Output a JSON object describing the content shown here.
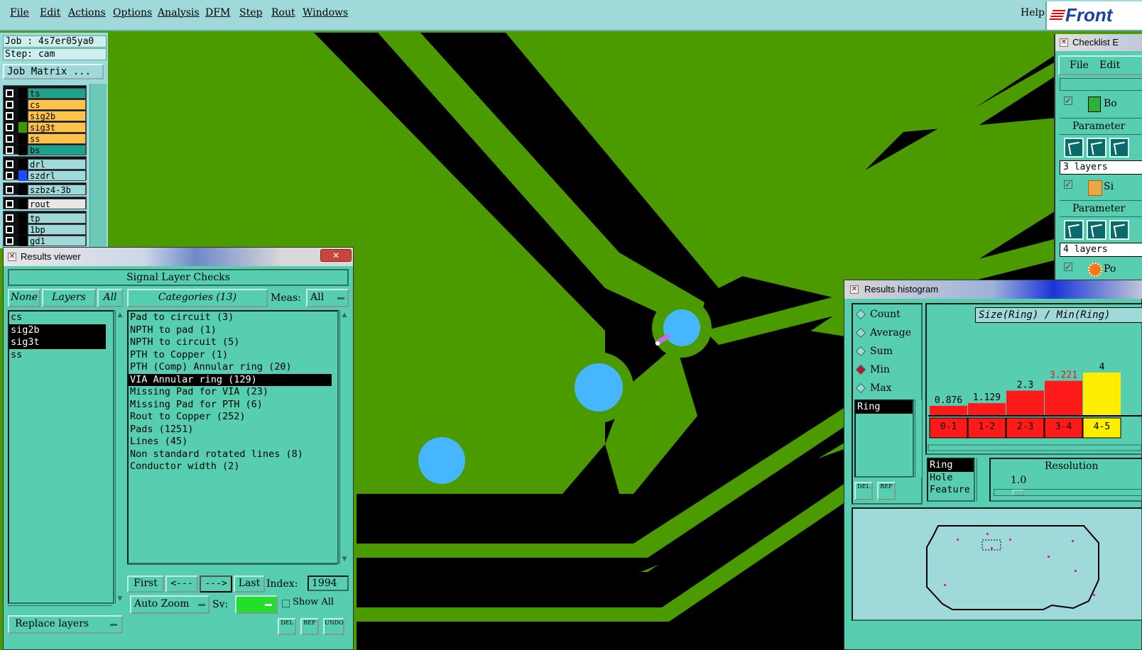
{
  "menu": {
    "items": [
      "File",
      "Edit",
      "Actions",
      "Options",
      "Analysis",
      "DFM",
      "Step",
      "Rout",
      "Windows"
    ],
    "help": "Help",
    "logo": "Front"
  },
  "left_panel": {
    "job": "Job : 4s7er05ya0",
    "step": "Step: cam",
    "job_matrix": "Job Matrix ...",
    "layers": [
      {
        "name": "ts",
        "color": "#1ea28c",
        "swatch": "#000000",
        "flag": "↵"
      },
      {
        "name": "cs",
        "color": "#ffc24a",
        "swatch": "#000000",
        "flag": "↵"
      },
      {
        "name": "sig2b",
        "color": "#ffc24a",
        "swatch": "#000000",
        "flag": "↵"
      },
      {
        "name": "sig3t",
        "color": "#ffc24a",
        "swatch": "#3a9a00",
        "flag": "↵"
      },
      {
        "name": "ss",
        "color": "#ffc24a",
        "swatch": "#000000",
        "flag": "↵"
      },
      {
        "name": "bs",
        "color": "#1ea28c",
        "swatch": "#000000",
        "flag": ""
      },
      {
        "name": "drl",
        "color": "#9fd9d9",
        "swatch": "#000000",
        "flag": ""
      },
      {
        "name": "szdrl",
        "color": "#9fd9d9",
        "swatch": "#1d4bff",
        "flag": "⊞"
      },
      {
        "name": "szbz4-3b",
        "color": "#9fd9d9",
        "swatch": "#000000",
        "flag": ""
      },
      {
        "name": "rout",
        "color": "#e6e6e6",
        "swatch": "#000000",
        "flag": ""
      },
      {
        "name": "tp",
        "color": "#9fd9d9",
        "swatch": "#000000",
        "flag": ""
      },
      {
        "name": "1bp",
        "color": "#9fd9d9",
        "swatch": "#000000",
        "flag": ""
      },
      {
        "name": "gd1",
        "color": "#9fd9d9",
        "swatch": "#000000",
        "flag": "↵"
      }
    ]
  },
  "results_viewer": {
    "title": "Results viewer",
    "header": "Signal Layer Checks",
    "none_label": "None",
    "layers_label": "Layers",
    "all_label": "All",
    "categories_label": "Categories (13)",
    "meas_label": "Meas:",
    "meas_value": "All",
    "layer_list": [
      {
        "name": "cs",
        "selected": false
      },
      {
        "name": "sig2b",
        "selected": true
      },
      {
        "name": "sig3t",
        "selected": true
      },
      {
        "name": "ss",
        "selected": false
      }
    ],
    "categories": [
      {
        "name": "Pad to circuit (3)",
        "selected": false
      },
      {
        "name": "NPTH to pad (1)",
        "selected": false
      },
      {
        "name": "NPTH to circuit (5)",
        "selected": false
      },
      {
        "name": "PTH to Copper (1)",
        "selected": false
      },
      {
        "name": "PTH (Comp) Annular ring (20)",
        "selected": false
      },
      {
        "name": "VIA Annular ring (129)",
        "selected": true
      },
      {
        "name": "Missing Pad for VIA (23)",
        "selected": false
      },
      {
        "name": "Missing Pad for PTH (6)",
        "selected": false
      },
      {
        "name": "Rout to Copper (252)",
        "selected": false
      },
      {
        "name": "Pads (1251)",
        "selected": false
      },
      {
        "name": "Lines (45)",
        "selected": false
      },
      {
        "name": "Non standard rotated lines (8)",
        "selected": false
      },
      {
        "name": "Conductor width (2)",
        "selected": false
      }
    ],
    "first": "First",
    "prev": "<---",
    "next": "--->",
    "last": "Last",
    "index_label": "Index:",
    "index_value": "1994",
    "auto_zoom": "Auto Zoom",
    "sv_label": "Sv:",
    "show_all": "Show All",
    "replace_layers": "Replace layers",
    "del": "DEL",
    "ref": "REF",
    "undo": "UNDO"
  },
  "histogram": {
    "title": "Results histogram",
    "modes": [
      {
        "label": "Count",
        "selected": false
      },
      {
        "label": "Average",
        "selected": false
      },
      {
        "label": "Sum",
        "selected": false
      },
      {
        "label": "Min",
        "selected": true
      },
      {
        "label": "Max",
        "selected": false
      }
    ],
    "field_value": "Ring",
    "chart_title": "Size(Ring) / Min(Ring)",
    "bars": [
      {
        "range": "0-1",
        "value": "0.876",
        "color": "#ff1a1a",
        "label_color": "#000000"
      },
      {
        "range": "1-2",
        "value": "1.129",
        "color": "#ff1a1a",
        "label_color": "#000000"
      },
      {
        "range": "2-3",
        "value": "2.3",
        "color": "#ff1a1a",
        "label_color": "#000000"
      },
      {
        "range": "3-4",
        "value": "3.221",
        "color": "#ff1a1a",
        "label_color": "#e8161d"
      },
      {
        "range": "4-5",
        "value": "4",
        "color": "#ffee00",
        "label_color": "#000000"
      }
    ],
    "by_list": [
      "Ring",
      "Hole",
      "Feature"
    ],
    "resolution_label": "Resolution",
    "resolution_value": "1.0",
    "del": "DEL",
    "ref": "REF"
  },
  "checklist": {
    "title": "Checklist E",
    "menu": [
      "File",
      "Edit"
    ],
    "rows": [
      {
        "label": "Bo",
        "icon": "drill-icon"
      },
      {
        "label": "Si",
        "icon": "signal-icon"
      },
      {
        "label": "Po",
        "icon": "power-icon"
      }
    ],
    "param_label": "Parameter",
    "layers_3": "3 layers",
    "layers_4": "4 layers",
    "param_label_2": "Parameter"
  }
}
